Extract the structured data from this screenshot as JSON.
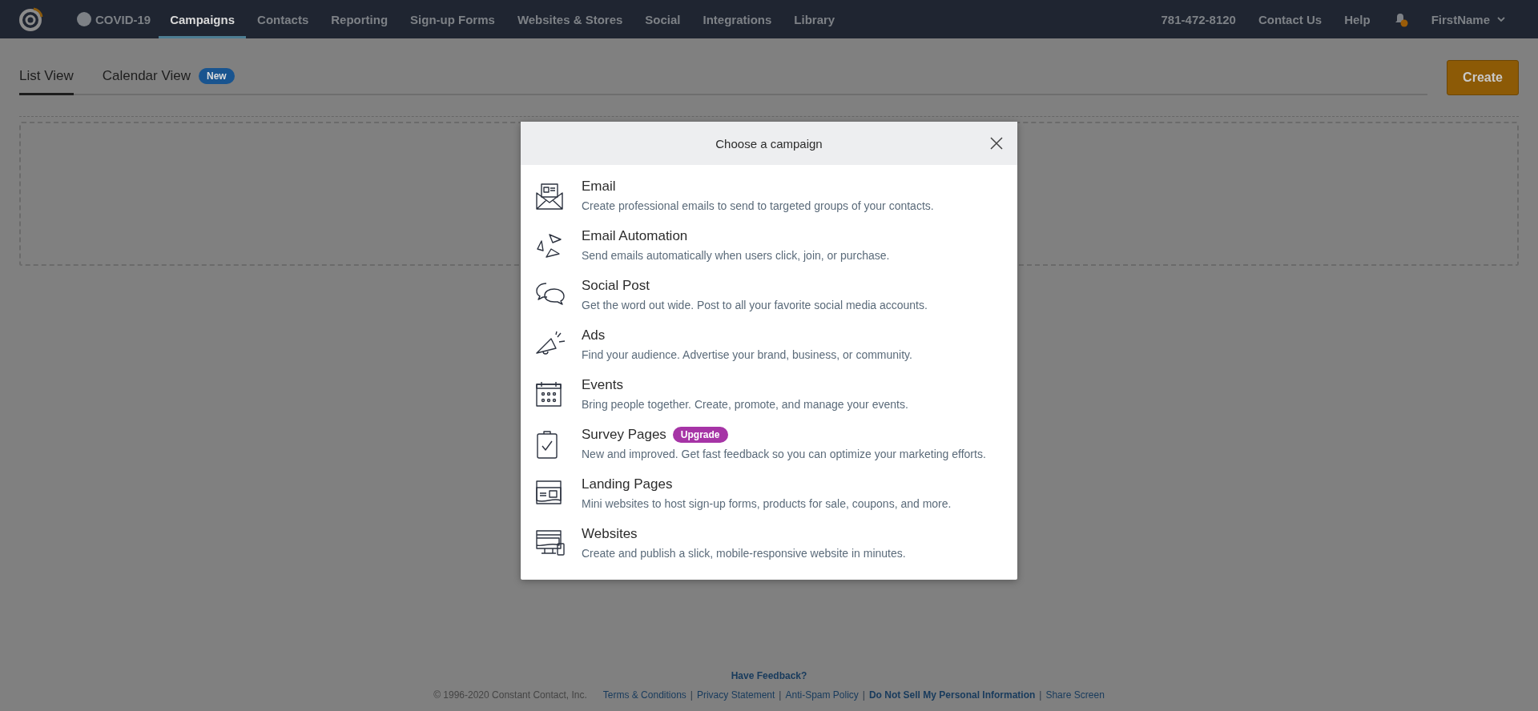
{
  "nav": {
    "covid": "COVID-19",
    "items": [
      {
        "label": "Campaigns",
        "selected": true
      },
      {
        "label": "Contacts",
        "selected": false
      },
      {
        "label": "Reporting",
        "selected": false
      },
      {
        "label": "Sign-up Forms",
        "selected": false
      },
      {
        "label": "Websites & Stores",
        "selected": false
      },
      {
        "label": "Social",
        "selected": false
      },
      {
        "label": "Integrations",
        "selected": false
      },
      {
        "label": "Library",
        "selected": false
      }
    ],
    "phone": "781-472-8120",
    "contact": "Contact Us",
    "help": "Help",
    "user": "FirstName"
  },
  "tabs": [
    {
      "label": "List View",
      "selected": true
    },
    {
      "label": "Calendar View",
      "selected": false,
      "badge": "New"
    }
  ],
  "create_button": "Create",
  "modal": {
    "title": "Choose a campaign",
    "items": [
      {
        "title": "Email",
        "description": "Create professional emails to send to targeted groups of your contacts."
      },
      {
        "title": "Email Automation",
        "description": "Send emails automatically when users click, join, or purchase."
      },
      {
        "title": "Social Post",
        "description": "Get the word out wide. Post to all your favorite social media accounts."
      },
      {
        "title": "Ads",
        "description": "Find your audience. Advertise your brand, business, or community."
      },
      {
        "title": "Events",
        "description": "Bring people together. Create, promote, and manage your events."
      },
      {
        "title": "Survey Pages",
        "badge": "Upgrade",
        "description": "New and improved. Get fast feedback so you can optimize your marketing efforts."
      },
      {
        "title": "Landing Pages",
        "description": "Mini websites to host sign-up forms, products for sale, coupons, and more."
      },
      {
        "title": "Websites",
        "description": "Create and publish a slick, mobile-responsive website in minutes."
      }
    ]
  },
  "footer": {
    "feedback": "Have Feedback?",
    "copyright": "© 1996-2020 Constant Contact, Inc.",
    "links": [
      {
        "kind": "link",
        "label": "Terms & Conditions",
        "bold": false
      },
      {
        "kind": "separator",
        "label": "|"
      },
      {
        "kind": "link",
        "label": "Privacy Statement",
        "bold": false
      },
      {
        "kind": "separator",
        "label": "|"
      },
      {
        "kind": "link",
        "label": "Anti-Spam Policy",
        "bold": false
      },
      {
        "kind": "separator",
        "label": "|"
      },
      {
        "kind": "link",
        "label": "Do Not Sell My Personal Information",
        "bold": true
      },
      {
        "kind": "separator",
        "label": "|"
      },
      {
        "kind": "link",
        "label": "Share Screen",
        "bold": false
      }
    ]
  }
}
